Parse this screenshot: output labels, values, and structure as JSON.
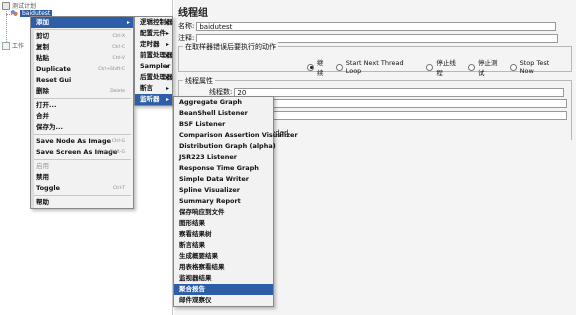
{
  "tree": {
    "test_plan": "测试计划",
    "thread_group": "baidutest",
    "workbench": "工作"
  },
  "panel": {
    "title": "线程组",
    "name_label": "名称:",
    "name_value": "baidutest",
    "comment_label": "注释:",
    "error_section": "在取样器错误后要执行的动作",
    "radio_options": [
      {
        "label": "继续",
        "selected": true
      },
      {
        "label": "Start Next Thread Loop",
        "selected": false
      },
      {
        "label": "停止线程",
        "selected": false
      },
      {
        "label": "停止测试",
        "selected": false
      },
      {
        "label": "Stop Test Now",
        "selected": false
      }
    ],
    "thread_props": "线程属性",
    "threads_label": "线程数:",
    "threads_value": "20",
    "partial_text": "eded"
  },
  "context_menu": {
    "items": [
      {
        "label": "添加",
        "shortcut": "",
        "submenu": true,
        "highlighted": true
      },
      {
        "sep": true
      },
      {
        "label": "剪切",
        "shortcut": "Ctrl-X"
      },
      {
        "label": "复制",
        "shortcut": "Ctrl-C"
      },
      {
        "label": "粘贴",
        "shortcut": "Ctrl-V"
      },
      {
        "label": "Duplicate",
        "shortcut": "Ctrl+Shift-C"
      },
      {
        "label": "Reset Gui",
        "shortcut": ""
      },
      {
        "label": "删除",
        "shortcut": "Delete"
      },
      {
        "sep": true
      },
      {
        "label": "打开...",
        "shortcut": ""
      },
      {
        "label": "合并",
        "shortcut": ""
      },
      {
        "label": "保存为...",
        "shortcut": ""
      },
      {
        "sep": true
      },
      {
        "label": "Save Node As Image",
        "shortcut": "Ctrl-G"
      },
      {
        "label": "Save Screen As Image",
        "shortcut": "Ctrl+Shift-G"
      },
      {
        "sep": true
      },
      {
        "label": "启用",
        "shortcut": "",
        "disabled": true
      },
      {
        "label": "禁用",
        "shortcut": ""
      },
      {
        "label": "Toggle",
        "shortcut": "Ctrl-T"
      },
      {
        "sep": true
      },
      {
        "label": "帮助",
        "shortcut": ""
      }
    ]
  },
  "add_menu": {
    "items": [
      {
        "label": "逻辑控制器"
      },
      {
        "label": "配置元件"
      },
      {
        "label": "定时器"
      },
      {
        "label": "前置处理器"
      },
      {
        "label": "Sampler"
      },
      {
        "label": "后置处理器"
      },
      {
        "label": "断言"
      },
      {
        "label": "监听器",
        "highlighted": true
      }
    ]
  },
  "listener_menu": {
    "items": [
      {
        "label": "Aggregate Graph"
      },
      {
        "label": "BeanShell Listener"
      },
      {
        "label": "BSF Listener"
      },
      {
        "label": "Comparison Assertion Visualizer"
      },
      {
        "label": "Distribution Graph (alpha)"
      },
      {
        "label": "JSR223 Listener"
      },
      {
        "label": "Response Time Graph"
      },
      {
        "label": "Simple Data Writer"
      },
      {
        "label": "Spline Visualizer"
      },
      {
        "label": "Summary Report"
      },
      {
        "label": "保存响应到文件"
      },
      {
        "label": "图形结果"
      },
      {
        "label": "察看结果树"
      },
      {
        "label": "断言结果"
      },
      {
        "label": "生成概要结果"
      },
      {
        "label": "用表格察看结果"
      },
      {
        "label": "监视器结果"
      },
      {
        "label": "聚合报告",
        "highlighted": true
      },
      {
        "label": "邮件观察仪"
      }
    ]
  }
}
